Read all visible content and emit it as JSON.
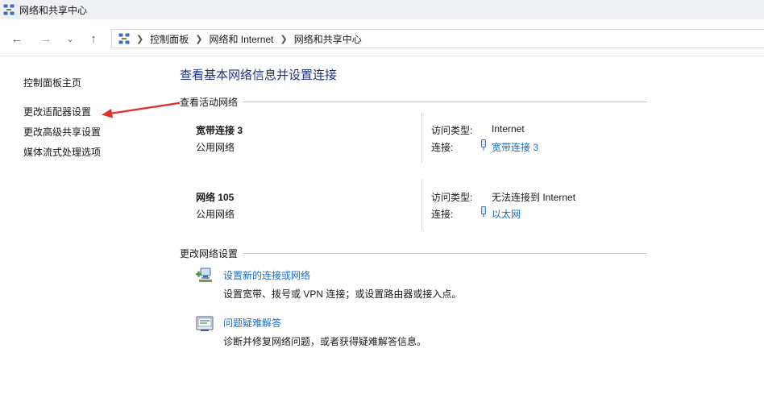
{
  "window": {
    "title": "网络和共享中心"
  },
  "breadcrumb": [
    "控制面板",
    "网络和 Internet",
    "网络和共享中心"
  ],
  "sidebar": {
    "items": [
      {
        "label": "控制面板主页"
      },
      {
        "label": "更改适配器设置"
      },
      {
        "label": "更改高级共享设置"
      },
      {
        "label": "媒体流式处理选项"
      }
    ]
  },
  "main": {
    "title": "查看基本网络信息并设置连接",
    "active_header": "查看活动网络",
    "networks": [
      {
        "name": "宽带连接 3",
        "category": "公用网络",
        "access_label": "访问类型:",
        "access_value": "Internet",
        "conn_label": "连接:",
        "conn_value": "宽带连接 3"
      },
      {
        "name": "网络 105",
        "category": "公用网络",
        "access_label": "访问类型:",
        "access_value": "无法连接到 Internet",
        "conn_label": "连接:",
        "conn_value": "以太网"
      }
    ],
    "change_header": "更改网络设置",
    "tasks": [
      {
        "link": "设置新的连接或网络",
        "desc": "设置宽带、拨号或 VPN 连接；或设置路由器或接入点。",
        "icon": "new-connection-icon"
      },
      {
        "link": "问题疑难解答",
        "desc": "诊断并修复网络问题，或者获得疑难解答信息。",
        "icon": "troubleshoot-icon"
      }
    ]
  },
  "annotation": {
    "color": "#e0302a"
  }
}
